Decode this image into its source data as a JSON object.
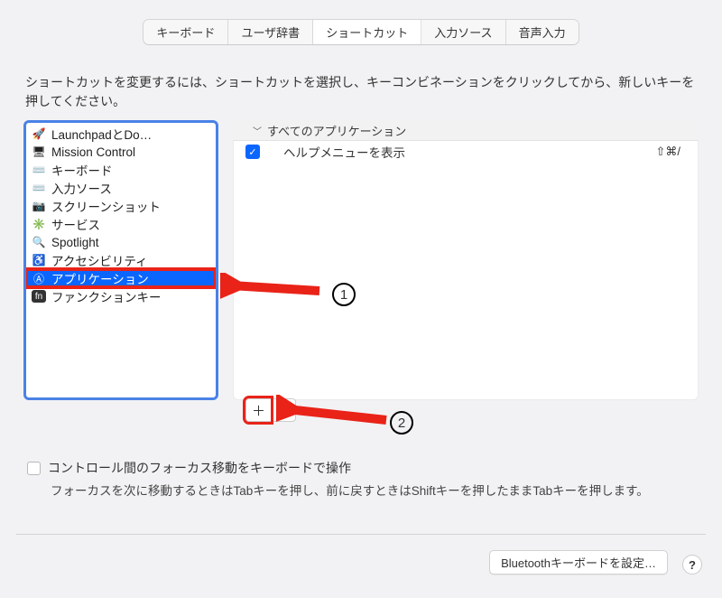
{
  "tabs": {
    "keyboard": "キーボード",
    "user_dict": "ユーザ辞書",
    "shortcuts": "ショートカット",
    "input_sources": "入力ソース",
    "dictation": "音声入力"
  },
  "description": "ショートカットを変更するには、ショートカットを選択し、キーコンビネーションをクリックしてから、新しいキーを押してください。",
  "sidebar": {
    "items": [
      {
        "label": "LaunchpadとDo…",
        "icon": "🚀"
      },
      {
        "label": "Mission Control",
        "icon": "🖥"
      },
      {
        "label": "キーボード",
        "icon": "⌨️"
      },
      {
        "label": "入力ソース",
        "icon": "⌨️"
      },
      {
        "label": "スクリーンショット",
        "icon": "📷"
      },
      {
        "label": "サービス",
        "icon": "✳️"
      },
      {
        "label": "Spotlight",
        "icon": "🔍"
      },
      {
        "label": "アクセシビリティ",
        "icon": "♿️"
      },
      {
        "label": "アプリケーション",
        "icon": "🅰️"
      },
      {
        "label": "ファンクションキー",
        "icon": "fn"
      }
    ]
  },
  "right": {
    "group_header": "すべてのアプリケーション",
    "row1_label": "ヘルプメニューを表示",
    "row1_shortcut": "⇧⌘/"
  },
  "focus": {
    "checkbox_label": "コントロール間のフォーカス移動をキーボードで操作",
    "help_text": "フォーカスを次に移動するときはTabキーを押し、前に戻すときはShiftキーを押したままTabキーを押します。"
  },
  "buttons": {
    "bluetooth": "Bluetoothキーボードを設定…",
    "help": "?",
    "plus": "＋",
    "minus": "−"
  },
  "annotations": {
    "one": "1",
    "two": "2"
  }
}
